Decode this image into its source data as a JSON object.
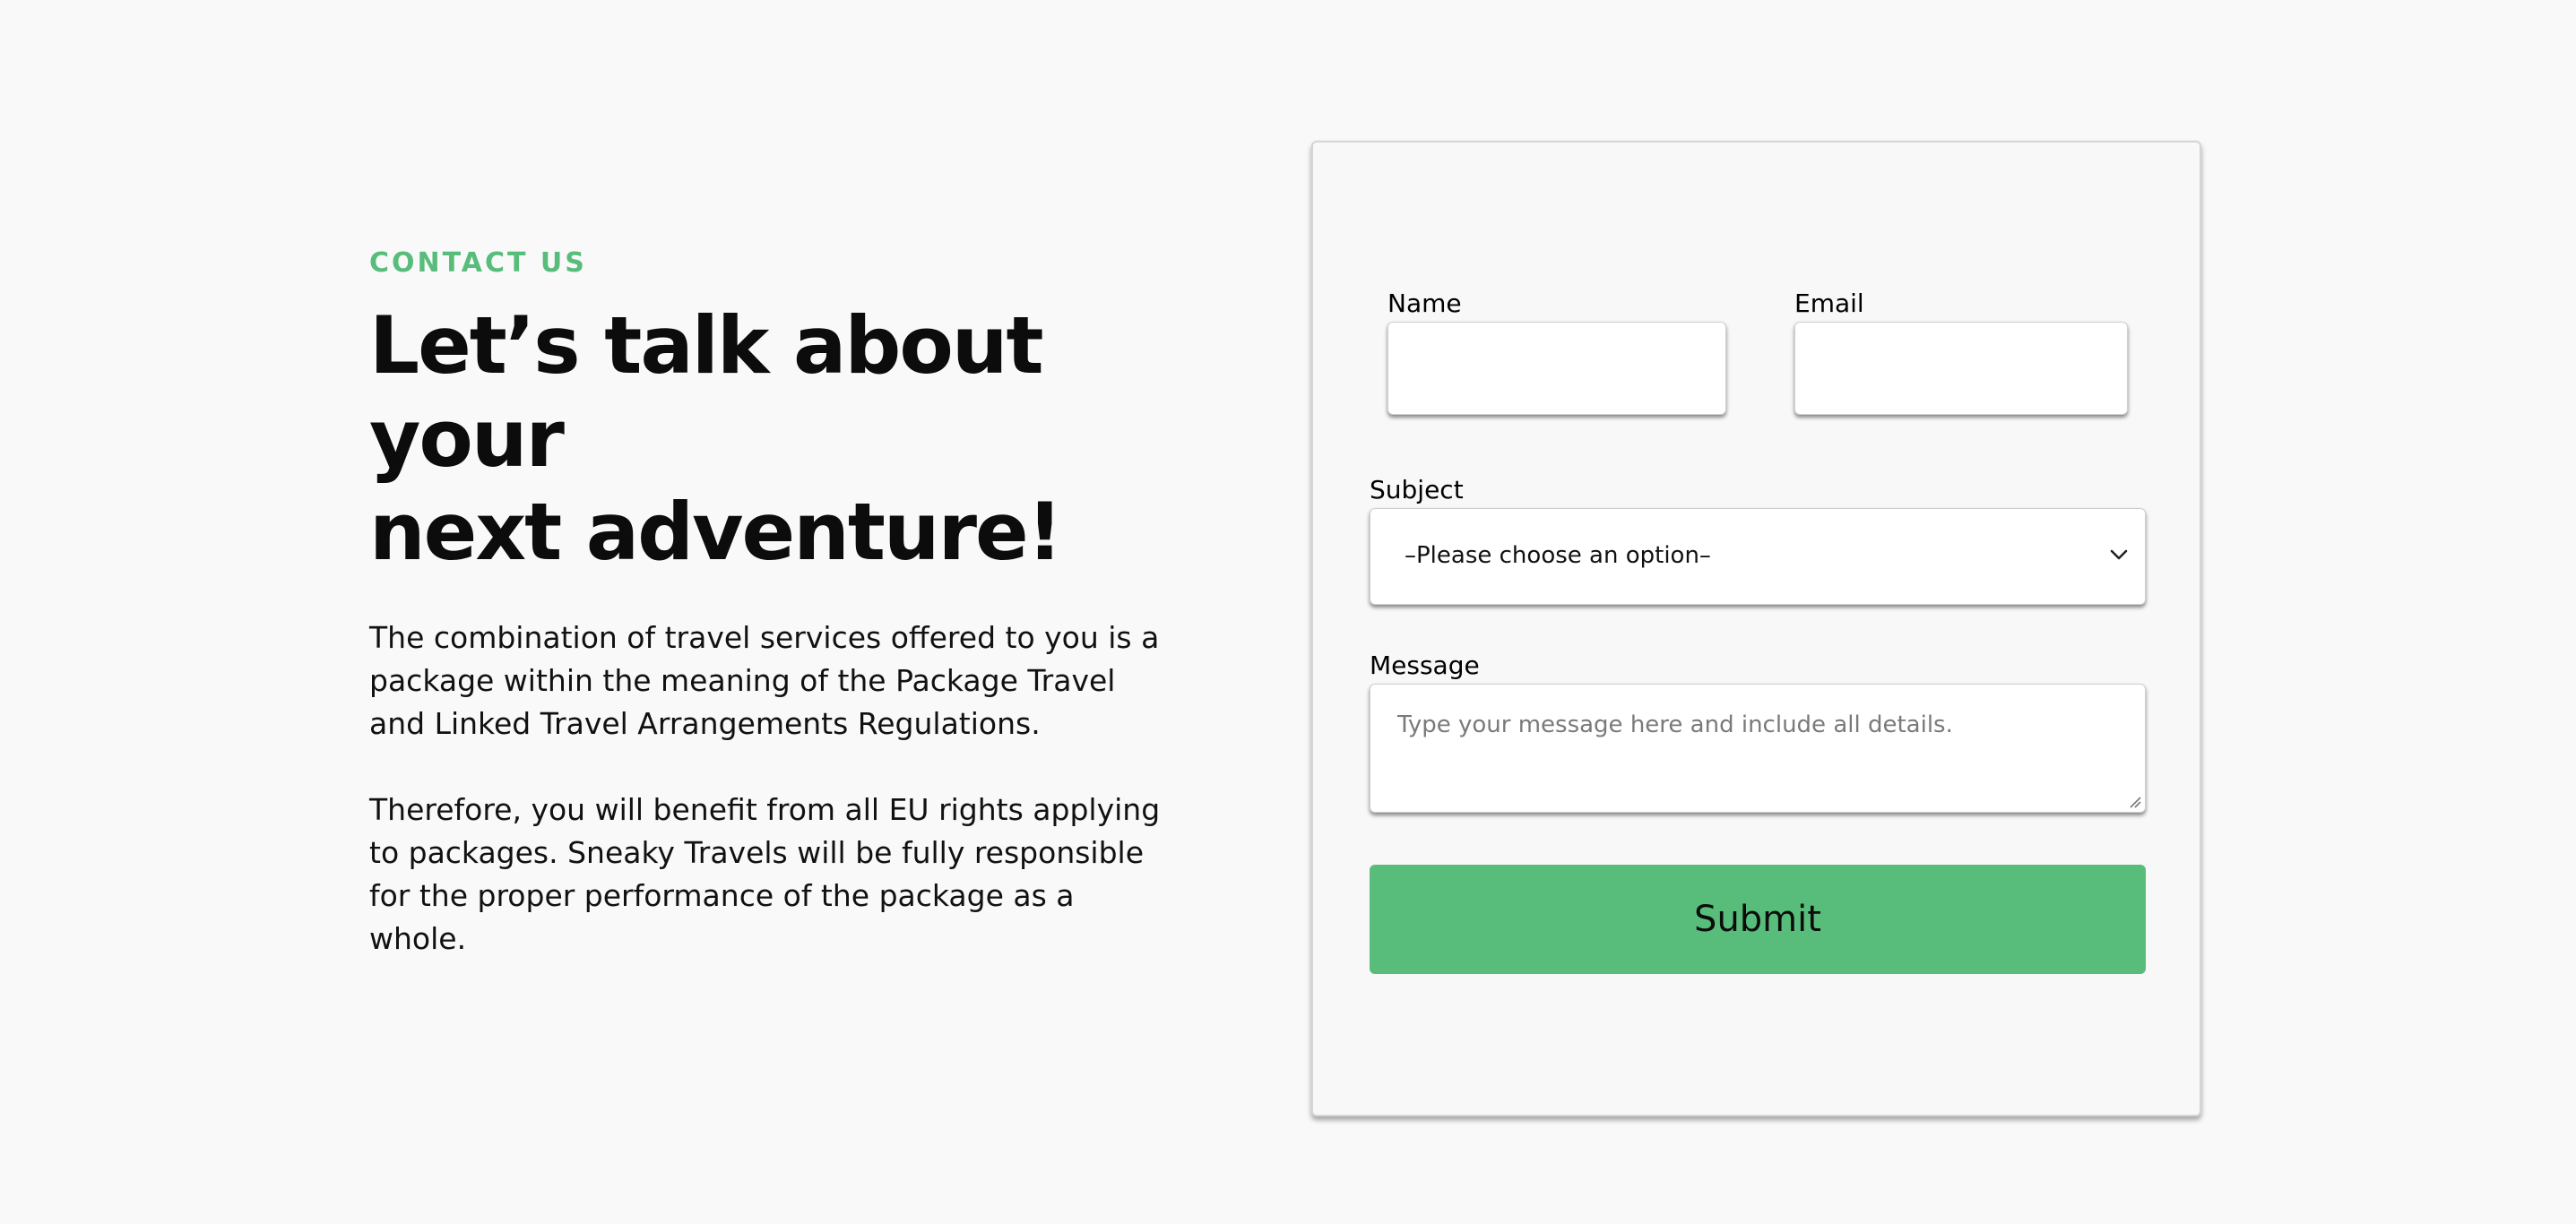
{
  "intro": {
    "eyebrow": "CONTACT US",
    "headline_line1": "Let’s talk about your",
    "headline_line2": "next adventure!",
    "paragraph1": "The combination of travel services offered to you is a package within the meaning of the Package Travel and Linked Travel Arrangements Regulations.",
    "paragraph2": "Therefore, you will benefit from all EU rights applying to packages. Sneaky Travels will be fully responsible for the proper performance of the package as a whole."
  },
  "form": {
    "name_label": "Name",
    "name_value": "",
    "email_label": "Email",
    "email_value": "",
    "subject_label": "Subject",
    "subject_selected": "–Please choose an option–",
    "message_label": "Message",
    "message_placeholder": "Type your message here and include all details.",
    "submit_label": "Submit"
  },
  "icons": {
    "select_chevron": "chevron-down-icon",
    "textarea_resize": "resize-handle-icon"
  },
  "colors": {
    "accent": "#58bd7b",
    "background": "#f9f9f9",
    "heading": "#0c0c0c"
  }
}
